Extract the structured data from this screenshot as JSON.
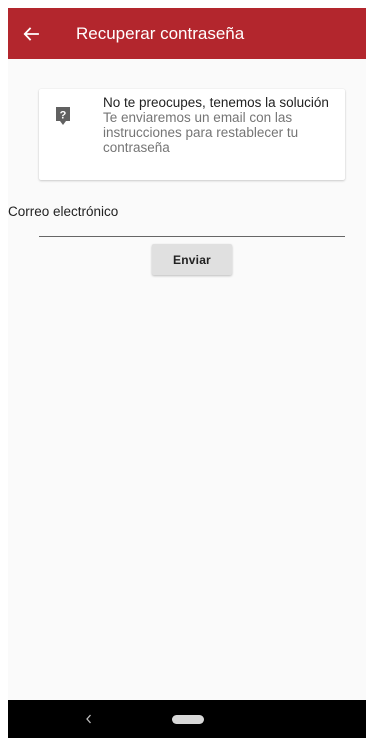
{
  "header": {
    "title": "Recuperar contraseña",
    "back_icon": "arrow-left-icon",
    "background_color": "#b3262d"
  },
  "info_card": {
    "icon": "question-help-icon",
    "title": "No te preocupes, tenemos la solución",
    "body": "Te enviaremos un email con las instrucciones para restablecer tu contraseña"
  },
  "form": {
    "email_label": "Correo electrónico",
    "email_value": ""
  },
  "actions": {
    "send_label": "Enviar"
  },
  "system_nav": {
    "back_icon": "chevron-left-icon",
    "home_icon": "home-pill-icon"
  }
}
